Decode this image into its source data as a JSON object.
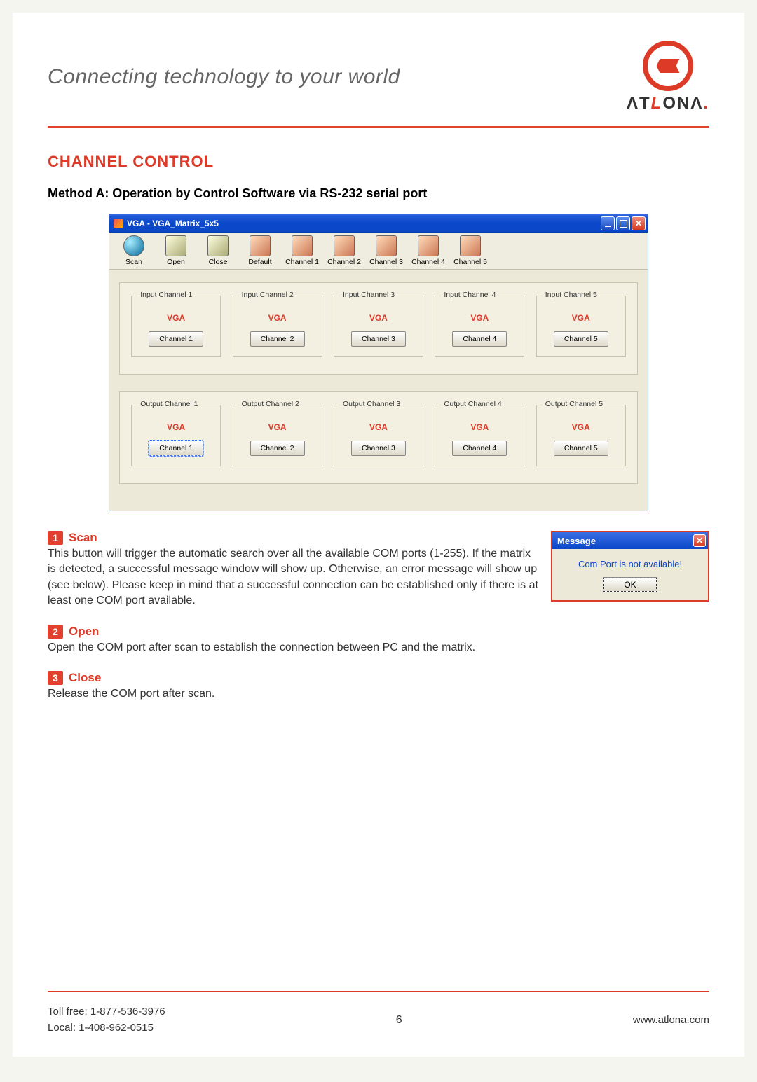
{
  "header": {
    "tagline": "Connecting technology to your world",
    "brand": "ATLONA"
  },
  "section": {
    "title": "CHANNEL CONTROL",
    "method_a": "Method A: Operation by Control Software via RS-232 serial port"
  },
  "app": {
    "window_title": "VGA - VGA_Matrix_5x5",
    "toolbar": [
      {
        "label": "Scan"
      },
      {
        "label": "Open"
      },
      {
        "label": "Close"
      },
      {
        "label": "Default"
      },
      {
        "label": "Channel 1"
      },
      {
        "label": "Channel 2"
      },
      {
        "label": "Channel 3"
      },
      {
        "label": "Channel 4"
      },
      {
        "label": "Channel 5"
      }
    ],
    "inputs": [
      {
        "legend": "Input Channel 1",
        "type": "VGA",
        "btn": "Channel 1"
      },
      {
        "legend": "Input Channel 2",
        "type": "VGA",
        "btn": "Channel 2"
      },
      {
        "legend": "Input Channel 3",
        "type": "VGA",
        "btn": "Channel 3"
      },
      {
        "legend": "Input Channel 4",
        "type": "VGA",
        "btn": "Channel 4"
      },
      {
        "legend": "Input Channel 5",
        "type": "VGA",
        "btn": "Channel 5"
      }
    ],
    "outputs": [
      {
        "legend": "Output Channel 1",
        "type": "VGA",
        "btn": "Channel 1"
      },
      {
        "legend": "Output Channel 2",
        "type": "VGA",
        "btn": "Channel 2"
      },
      {
        "legend": "Output Channel 3",
        "type": "VGA",
        "btn": "Channel 3"
      },
      {
        "legend": "Output Channel 4",
        "type": "VGA",
        "btn": "Channel 4"
      },
      {
        "legend": "Output Channel 5",
        "type": "VGA",
        "btn": "Channel 5"
      }
    ]
  },
  "features": [
    {
      "num": "1",
      "title": "Scan",
      "body": "This button will trigger the automatic search over all the available COM ports (1-255). If the matrix is detected, a successful message window will show up. Otherwise, an error message will show up (see below). Please keep in mind that a successful connection can be established only if there is at least one COM port available."
    },
    {
      "num": "2",
      "title": "Open",
      "body": "Open the COM port after scan to establish the connection between PC and the matrix."
    },
    {
      "num": "3",
      "title": "Close",
      "body": "Release the COM port after scan."
    }
  ],
  "message_dialog": {
    "title": "Message",
    "text": "Com Port is not available!",
    "ok": "OK"
  },
  "footer": {
    "toll_free_label": "Toll free:",
    "toll_free": "1-877-536-3976",
    "local_label": "Local:",
    "local": "1-408-962-0515",
    "page": "6",
    "url": "www.atlona.com"
  }
}
